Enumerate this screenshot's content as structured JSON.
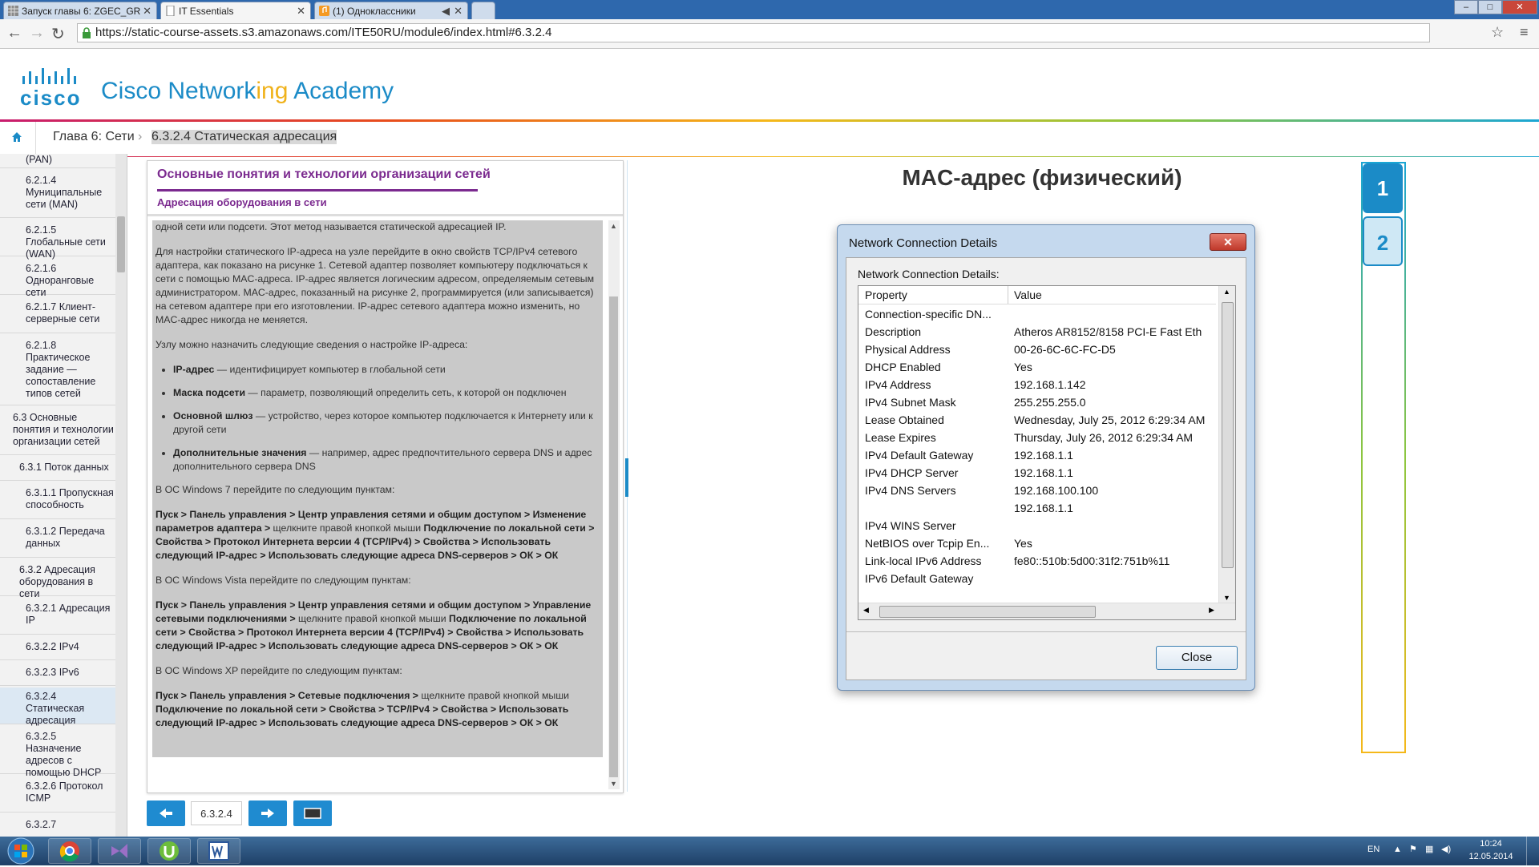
{
  "browser": {
    "tabs": [
      {
        "label": "Запуск главы 6: ZGEC_GR"
      },
      {
        "label": "IT Essentials"
      },
      {
        "label": "(1) Одноклассники"
      }
    ],
    "url": "https://static-course-assets.s3.amazonaws.com/ITE50RU/module6/index.html#6.3.2.4"
  },
  "header": {
    "brand_word": "cisco",
    "title_part1": "Cisco Network",
    "title_part2": "ing",
    "title_part3": " Academy"
  },
  "breadcrumb": {
    "chapter": "Глава 6: Сети",
    "separator": "›",
    "current": "6.3.2.4 Статическая адресация"
  },
  "sidebar": {
    "items": [
      {
        "label": "(PAN)"
      },
      {
        "label": "6.2.1.4 Муниципальные сети (MAN)"
      },
      {
        "label": "6.2.1.5 Глобальные сети (WAN)"
      },
      {
        "label": "6.2.1.6 Одноранговые сети"
      },
      {
        "label": "6.2.1.7 Клиент-серверные сети"
      },
      {
        "label": "6.2.1.8 Практическое задание — сопоставление типов сетей"
      },
      {
        "label": "6.3 Основные понятия и технологии организации сетей"
      },
      {
        "label": "6.3.1 Поток данных"
      },
      {
        "label": "6.3.1.1 Пропускная способность"
      },
      {
        "label": "6.3.1.2 Передача данных"
      },
      {
        "label": "6.3.2 Адресация оборудования в сети"
      },
      {
        "label": "6.3.2.1 Адресация IP"
      },
      {
        "label": "6.3.2.2 IPv4"
      },
      {
        "label": "6.3.2.3 IPv6"
      },
      {
        "label": "6.3.2.4 Статическая адресация"
      },
      {
        "label": "6.3.2.5 Назначение адресов с помощью DHCP"
      },
      {
        "label": "6.3.2.6 Протокол ICMP"
      },
      {
        "label": "6.3.2.7"
      }
    ]
  },
  "panel": {
    "title": "Основные понятия и технологии организации сетей",
    "subtitle": "Адресация оборудования в сети",
    "p0": "одной сети или подсети. Этот метод называется статической адресацией IP.",
    "p1": "Для настройки статического IP-адреса на узле перейдите в окно свойств TCP/IPv4 сетевого адаптера, как показано на рисунке 1. Сетевой адаптер позволяет компьютеру подключаться к сети с помощью MAC-адреса. IP-адрес является логическим адресом, определяемым сетевым администратором. MAC-адрес, показанный на рисунке 2, программируется (или записывается) на сетевом адаптере при его изготовлении. IP-адрес сетевого адаптера можно изменить, но MAC-адрес никогда не меняется.",
    "p2": "Узлу можно назначить следующие сведения о настройке IP-адреса:",
    "bullets": [
      {
        "term": "IP-адрес",
        "text": " — идентифицирует компьютер в глобальной сети"
      },
      {
        "term": "Маска подсети",
        "text": " — параметр, позволяющий определить сеть, к которой он подключен"
      },
      {
        "term": "Основной шлюз",
        "text": " — устройство, через которое компьютер подключается к Интернету или к другой сети"
      },
      {
        "term": "Дополнительные значения",
        "text": " — например, адрес предпочтительного сервера DNS и адрес дополнительного сервера DNS"
      }
    ],
    "win7_intro": "В ОС Windows 7 перейдите по следующим пунктам:",
    "win7_a": "Пуск > Панель управления > Центр управления сетями и общим доступом > Изменение параметров адаптера >",
    "win7_b": " щелкните правой кнопкой мыши ",
    "win7_c": "Подключение по локальной сети > Свойства > Протокол Интернета версии 4 (TCP/IPv4) > Свойства > Использовать следующий IP-адрес > Использовать следующие адреса DNS-серверов > ОК > ОК",
    "vista_intro": "В ОС Windows Vista перейдите по следующим пунктам:",
    "vista_a": "Пуск > Панель управления > Центр управления сетями и общим доступом > Управление сетевыми подключениями >",
    "vista_b": " щелкните правой кнопкой мыши ",
    "vista_c": "Подключение по локальной сети > Свойства > Протокол Интернета версии 4 (TCP/IPv4) > Свойства > Использовать следующий IP-адрес > Использовать следующие адреса DNS-серверов > ОК > ОК",
    "xp_intro": "В ОС Windows XP перейдите по следующим пунктам:",
    "xp_a": "Пуск > Панель управления > Сетевые подключения >",
    "xp_b": " щелкните правой кнопкой мыши ",
    "xp_c": "Подключение по локальной сети > Свойства > TCP/IPv4 > Свойства > Использовать следующий IP-адрес > Использовать следующие адреса DNS-серверов > ОК > ОК"
  },
  "bottom_nav": {
    "page": "6.3.2.4"
  },
  "figure": {
    "title": "MAC-адрес (физический)",
    "tabs": [
      "1",
      "2"
    ],
    "active_tab": "2"
  },
  "dialog": {
    "title": "Network Connection Details",
    "close_x": "✕",
    "label": "Network Connection Details:",
    "col_property": "Property",
    "col_value": "Value",
    "rows": [
      {
        "p": "Connection-specific DN...",
        "v": ""
      },
      {
        "p": "Description",
        "v": "Atheros AR8152/8158 PCI-E Fast Eth"
      },
      {
        "p": "Physical Address",
        "v": "00-26-6C-6C-FC-D5"
      },
      {
        "p": "DHCP Enabled",
        "v": "Yes"
      },
      {
        "p": "IPv4 Address",
        "v": "192.168.1.142"
      },
      {
        "p": "IPv4 Subnet Mask",
        "v": "255.255.255.0"
      },
      {
        "p": "Lease Obtained",
        "v": "Wednesday, July 25, 2012 6:29:34 AM"
      },
      {
        "p": "Lease Expires",
        "v": "Thursday, July 26, 2012 6:29:34 AM"
      },
      {
        "p": "IPv4 Default Gateway",
        "v": "192.168.1.1"
      },
      {
        "p": "IPv4 DHCP Server",
        "v": "192.168.1.1"
      },
      {
        "p": "IPv4 DNS Servers",
        "v": "192.168.100.100"
      },
      {
        "p": "",
        "v": "192.168.1.1"
      },
      {
        "p": "IPv4 WINS Server",
        "v": ""
      },
      {
        "p": "NetBIOS over Tcpip En...",
        "v": "Yes"
      },
      {
        "p": "Link-local IPv6 Address",
        "v": "fe80::510b:5d00:31f2:751b%11"
      },
      {
        "p": "IPv6 Default Gateway",
        "v": ""
      }
    ],
    "close_label": "Close"
  },
  "taskbar": {
    "lang": "EN",
    "time": "10:24",
    "date": "12.05.2014"
  },
  "colors": {
    "cisco_blue": "#1b8bc7",
    "academy_gold": "#f0b21b",
    "panel_purple": "#7b2a8f",
    "nav_blue": "#1f8bd0"
  }
}
